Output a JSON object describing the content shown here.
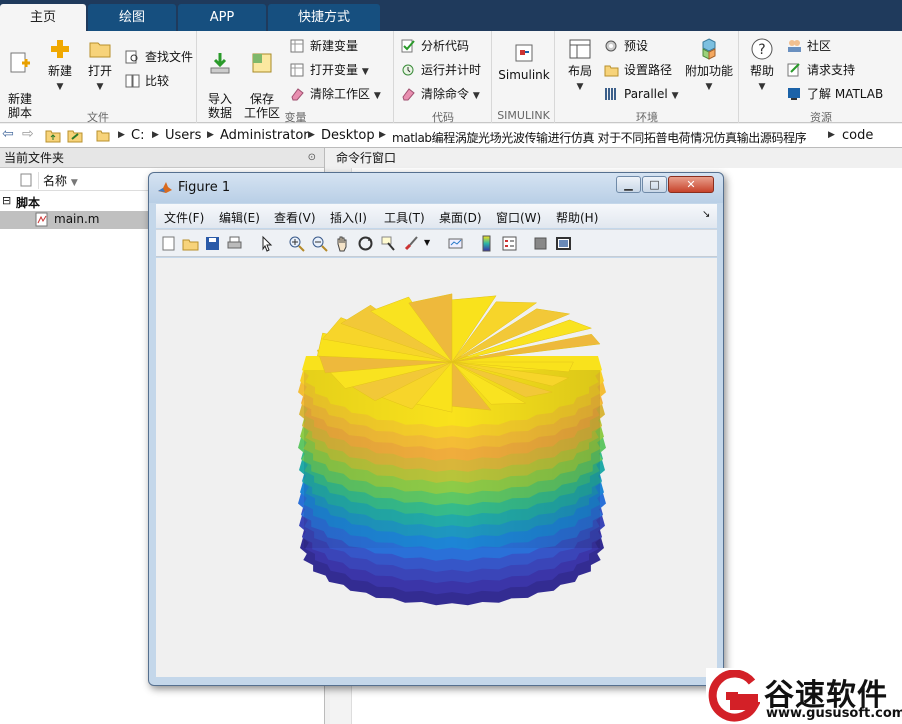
{
  "tabs": [
    {
      "label": "主页"
    },
    {
      "label": "绘图"
    },
    {
      "label": "APP"
    },
    {
      "label": "快捷方式"
    }
  ],
  "ribbon": {
    "file": {
      "new_script": "新建\n脚本",
      "new": "新建",
      "open": "打开",
      "find_files": "查找文件",
      "compare": "比较",
      "group": "文件"
    },
    "variable": {
      "import": "导入\n数据",
      "save_ws": "保存\n工作区",
      "new_var": "新建变量",
      "open_var": "打开变量",
      "clear_ws": "清除工作区",
      "group": "变量"
    },
    "code": {
      "analyze": "分析代码",
      "run_time": "运行并计时",
      "clear_cmd": "清除命令",
      "group": "代码"
    },
    "simulink": {
      "label": "Simulink",
      "group": "SIMULINK"
    },
    "env": {
      "layout": "布局",
      "prefs": "预设",
      "set_path": "设置路径",
      "parallel": "Parallel",
      "addons": "附加功能",
      "group": "环境"
    },
    "resources": {
      "help": "帮助",
      "community": "社区",
      "support": "请求支持",
      "learn": "了解 MATLAB",
      "group": "资源"
    }
  },
  "address": {
    "crumbs": [
      "C:",
      "Users",
      "Administrator",
      "Desktop",
      "matlab编程涡旋光场光波传输进行仿真 对于不同拓普电荷情况仿真输出源码程序",
      "code"
    ]
  },
  "left_panel": {
    "title": "当前文件夹",
    "col_name": "名称",
    "folder": "脚本",
    "file": "main.m"
  },
  "right_panel": {
    "title": "命令行窗口"
  },
  "figure": {
    "title": "Figure 1",
    "menu": [
      "文件(F)",
      "编辑(E)",
      "查看(V)",
      "插入(I)",
      "工具(T)",
      "桌面(D)",
      "窗口(W)",
      "帮助(H)"
    ]
  },
  "logo": {
    "cn": "谷速软件",
    "url": "www.gususoft.com"
  },
  "colors": {
    "ribbon_tab": "#164f7f",
    "tabbar": "#1f3a5c",
    "accent": "#d32027"
  }
}
